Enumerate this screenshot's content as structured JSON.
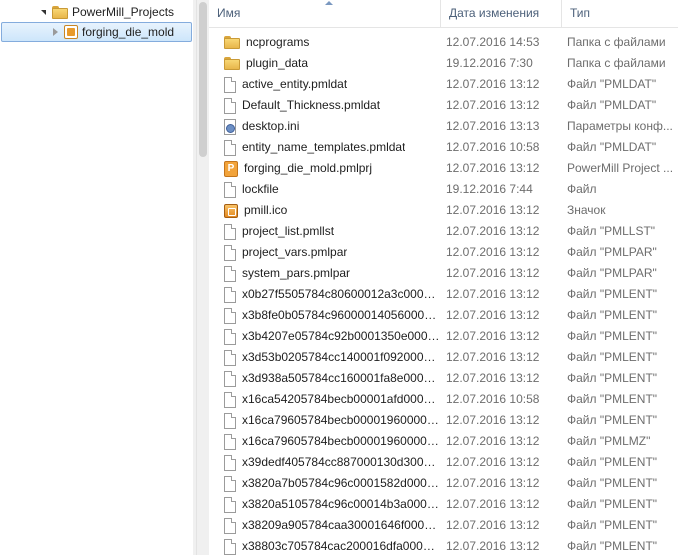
{
  "tree": {
    "items": [
      {
        "label": "PowerMill_Projects",
        "icon": "folder-icon",
        "expanded": true
      },
      {
        "label": "forging_die_mold",
        "icon": "project-icon",
        "expanded": false,
        "selected": true
      }
    ]
  },
  "columns": {
    "name": "Имя",
    "date": "Дата изменения",
    "type": "Тип"
  },
  "files": [
    {
      "name": "ncprograms",
      "date": "12.07.2016 14:53",
      "type": "Папка с файлами",
      "icon": "folder-icon"
    },
    {
      "name": "plugin_data",
      "date": "19.12.2016 7:30",
      "type": "Папка с файлами",
      "icon": "folder-icon"
    },
    {
      "name": "active_entity.pmldat",
      "date": "12.07.2016 13:12",
      "type": "Файл \"PMLDAT\"",
      "icon": "file-icon"
    },
    {
      "name": "Default_Thickness.pmldat",
      "date": "12.07.2016 13:12",
      "type": "Файл \"PMLDAT\"",
      "icon": "file-icon"
    },
    {
      "name": "desktop.ini",
      "date": "12.07.2016 13:13",
      "type": "Параметры конф...",
      "icon": "settings-icon"
    },
    {
      "name": "entity_name_templates.pmldat",
      "date": "12.07.2016 10:58",
      "type": "Файл \"PMLDAT\"",
      "icon": "file-icon"
    },
    {
      "name": "forging_die_mold.pmlprj",
      "date": "12.07.2016 13:12",
      "type": "PowerMill Project ...",
      "icon": "powermill-icon"
    },
    {
      "name": "lockfile",
      "date": "19.12.2016 7:44",
      "type": "Файл",
      "icon": "file-icon"
    },
    {
      "name": "pmill.ico",
      "date": "12.07.2016 13:12",
      "type": "Значок",
      "icon": "ico-icon"
    },
    {
      "name": "project_list.pmllst",
      "date": "12.07.2016 13:12",
      "type": "Файл \"PMLLST\"",
      "icon": "file-icon"
    },
    {
      "name": "project_vars.pmlpar",
      "date": "12.07.2016 13:12",
      "type": "Файл \"PMLPAR\"",
      "icon": "file-icon"
    },
    {
      "name": "system_pars.pmlpar",
      "date": "12.07.2016 13:12",
      "type": "Файл \"PMLPAR\"",
      "icon": "file-icon"
    },
    {
      "name": "x0b27f5505784c80600012a3c00000...",
      "date": "12.07.2016 13:12",
      "type": "Файл \"PMLENT\"",
      "icon": "file-icon"
    },
    {
      "name": "x3b8fe0b05784c960000140560000...",
      "date": "12.07.2016 13:12",
      "type": "Файл \"PMLENT\"",
      "icon": "file-icon"
    },
    {
      "name": "x3b4207e05784c92b0001350e0000...",
      "date": "12.07.2016 13:12",
      "type": "Файл \"PMLENT\"",
      "icon": "file-icon"
    },
    {
      "name": "x3d53b0205784cc140001f0920000...",
      "date": "12.07.2016 13:12",
      "type": "Файл \"PMLENT\"",
      "icon": "file-icon"
    },
    {
      "name": "x3d938a505784cc160001fa8e00000...",
      "date": "12.07.2016 13:12",
      "type": "Файл \"PMLENT\"",
      "icon": "file-icon"
    },
    {
      "name": "x16ca54205784becb00001afd0000...",
      "date": "12.07.2016 10:58",
      "type": "Файл \"PMLENT\"",
      "icon": "file-icon"
    },
    {
      "name": "x16ca79605784becb000019600000...",
      "date": "12.07.2016 13:12",
      "type": "Файл \"PMLENT\"",
      "icon": "file-icon"
    },
    {
      "name": "x16ca79605784becb000019600000...",
      "date": "12.07.2016 13:12",
      "type": "Файл \"PMLMZ\"",
      "icon": "file-icon"
    },
    {
      "name": "x39dedf405784cc887000130d30000...",
      "date": "12.07.2016 13:12",
      "type": "Файл \"PMLENT\"",
      "icon": "file-icon"
    },
    {
      "name": "x3820a7b05784c96c0001582d0000...",
      "date": "12.07.2016 13:12",
      "type": "Файл \"PMLENT\"",
      "icon": "file-icon"
    },
    {
      "name": "x3820a5105784c96c00014b3a0000...",
      "date": "12.07.2016 13:12",
      "type": "Файл \"PMLENT\"",
      "icon": "file-icon"
    },
    {
      "name": "x38209a905784caa30001646f00000...",
      "date": "12.07.2016 13:12",
      "type": "Файл \"PMLENT\"",
      "icon": "file-icon"
    },
    {
      "name": "x38803c705784cac200016dfa00000...",
      "date": "12.07.2016 13:12",
      "type": "Файл \"PMLENT\"",
      "icon": "file-icon"
    }
  ]
}
